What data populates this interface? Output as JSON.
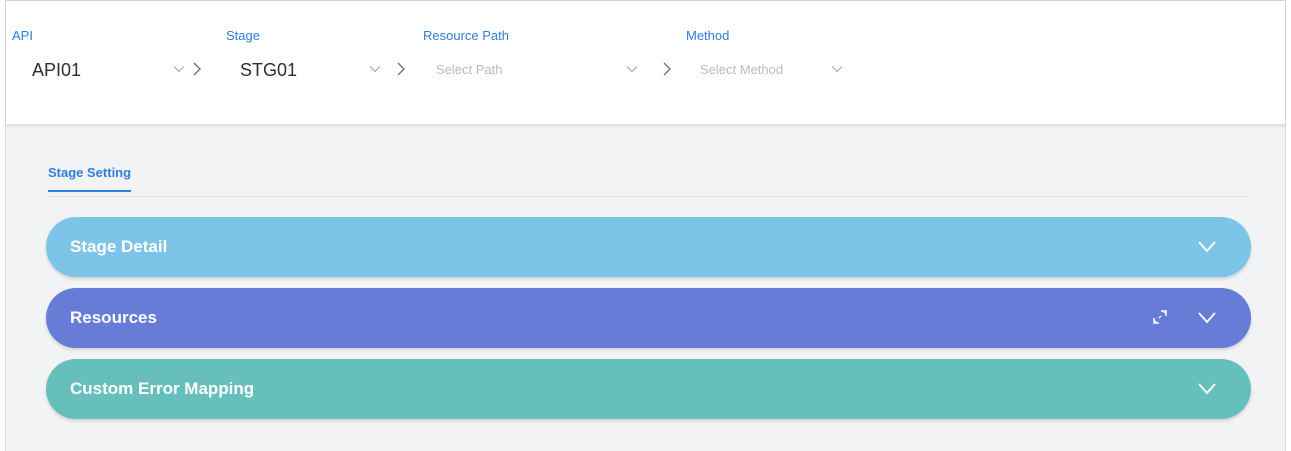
{
  "selectors": [
    {
      "label": "API",
      "value": "API01"
    },
    {
      "label": "Stage",
      "value": "STG01"
    },
    {
      "label": "Resource Path",
      "placeholder": "Select Path"
    },
    {
      "label": "Method",
      "placeholder": "Select Method"
    }
  ],
  "tabs": [
    {
      "label": "Stage Setting",
      "active": true
    }
  ],
  "panels": [
    {
      "title": "Stage Detail",
      "color": "#7cc4e8"
    },
    {
      "title": "Resources",
      "color": "#667cd6"
    },
    {
      "title": "Custom Error Mapping",
      "color": "#67bfbb"
    }
  ],
  "icons": {
    "dropdown": "chevron-down-icon",
    "separator": "chevron-right-icon",
    "expand": "expand-icon"
  },
  "colors": {
    "accent": "#2f7fd8",
    "placeholder": "#b7bcc1",
    "background": "#f2f3f4"
  }
}
